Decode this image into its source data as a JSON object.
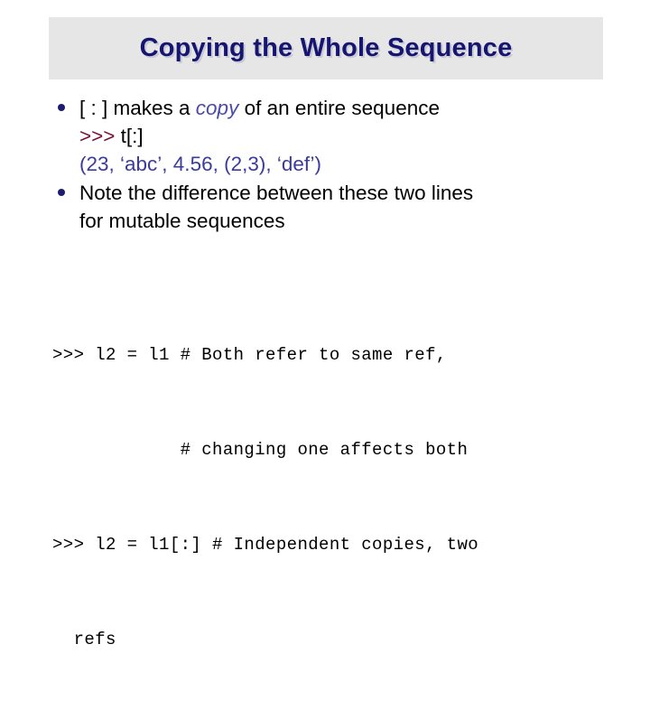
{
  "slide": {
    "title": "Copying the Whole Sequence",
    "title_color": "#161670",
    "title_band_color": "#e6e6e6",
    "background_color": "#ffffff"
  },
  "bullets": [
    {
      "marker": "bullet-dot",
      "lines": [
        {
          "segments": [
            {
              "text": "[ : ] makes a ",
              "style": "plain"
            },
            {
              "text": "copy",
              "style": "italic-accent"
            },
            {
              "text": " of an entire sequence",
              "style": "plain"
            }
          ]
        },
        {
          "segments": [
            {
              "text": ">>> ",
              "style": "prompt"
            },
            {
              "text": "t[:]",
              "style": "code"
            }
          ]
        },
        {
          "segments": [
            {
              "text": "(23, ‘abc’, 4.56, (2,3), ‘def’)",
              "style": "result"
            }
          ]
        }
      ]
    },
    {
      "marker": "bullet-dot",
      "lines": [
        {
          "segments": [
            {
              "text": "Note the difference between these two lines",
              "style": "plain"
            }
          ]
        },
        {
          "segments": [
            {
              "text": "for mutable sequences",
              "style": "plain"
            }
          ]
        }
      ]
    }
  ],
  "code_block": {
    "lines": [
      ">>> l2 = l1 # Both refer to same ref,",
      "            # changing one affects both",
      ">>> l2 = l1[:] # Independent copies, two",
      "  refs"
    ]
  },
  "colors": {
    "prompt": "#7a1038",
    "accent_italic": "#4a4aa8",
    "result": "#3b3b9c",
    "bullet_marker": "#1c1c70",
    "text": "#000000"
  }
}
